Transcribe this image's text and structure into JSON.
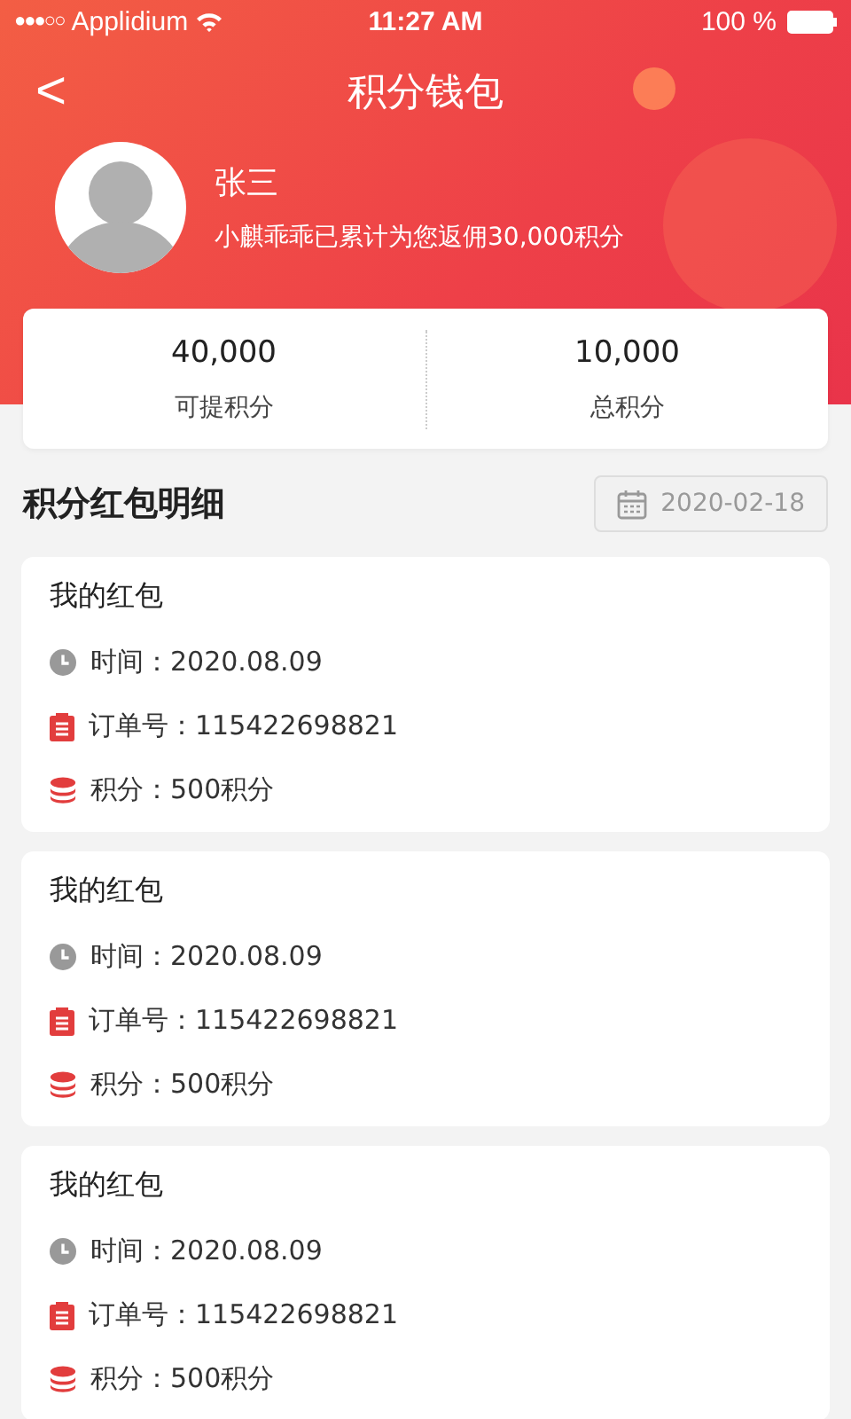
{
  "status_bar": {
    "signal": "●●●○○",
    "carrier": "Applidium",
    "time": "11:27 AM",
    "battery": "100 %"
  },
  "nav": {
    "back": "<",
    "title": "积分钱包"
  },
  "profile": {
    "name": "张三",
    "summary": "小麒乖乖已累计为您返佣30,000积分"
  },
  "stats": [
    {
      "value": "40,000",
      "label": "可提积分"
    },
    {
      "value": "10,000",
      "label": "总积分"
    }
  ],
  "section": {
    "title": "积分红包明细",
    "date": "2020-02-18"
  },
  "records": [
    {
      "title": "我的红包",
      "rows": [
        {
          "kind": "time",
          "text": "时间：2020.08.09"
        },
        {
          "kind": "order",
          "text": "订单号：115422698821"
        },
        {
          "kind": "points",
          "text": "积分：500积分"
        }
      ]
    },
    {
      "title": "我的红包",
      "rows": [
        {
          "kind": "time",
          "text": "时间：2020.08.09"
        },
        {
          "kind": "order",
          "text": "订单号：115422698821"
        },
        {
          "kind": "points",
          "text": "积分：500积分"
        }
      ]
    },
    {
      "title": "我的红包",
      "rows": [
        {
          "kind": "time",
          "text": "时间：2020.08.09"
        },
        {
          "kind": "order",
          "text": "订单号：115422698821"
        },
        {
          "kind": "points",
          "text": "积分：500积分"
        }
      ]
    }
  ]
}
